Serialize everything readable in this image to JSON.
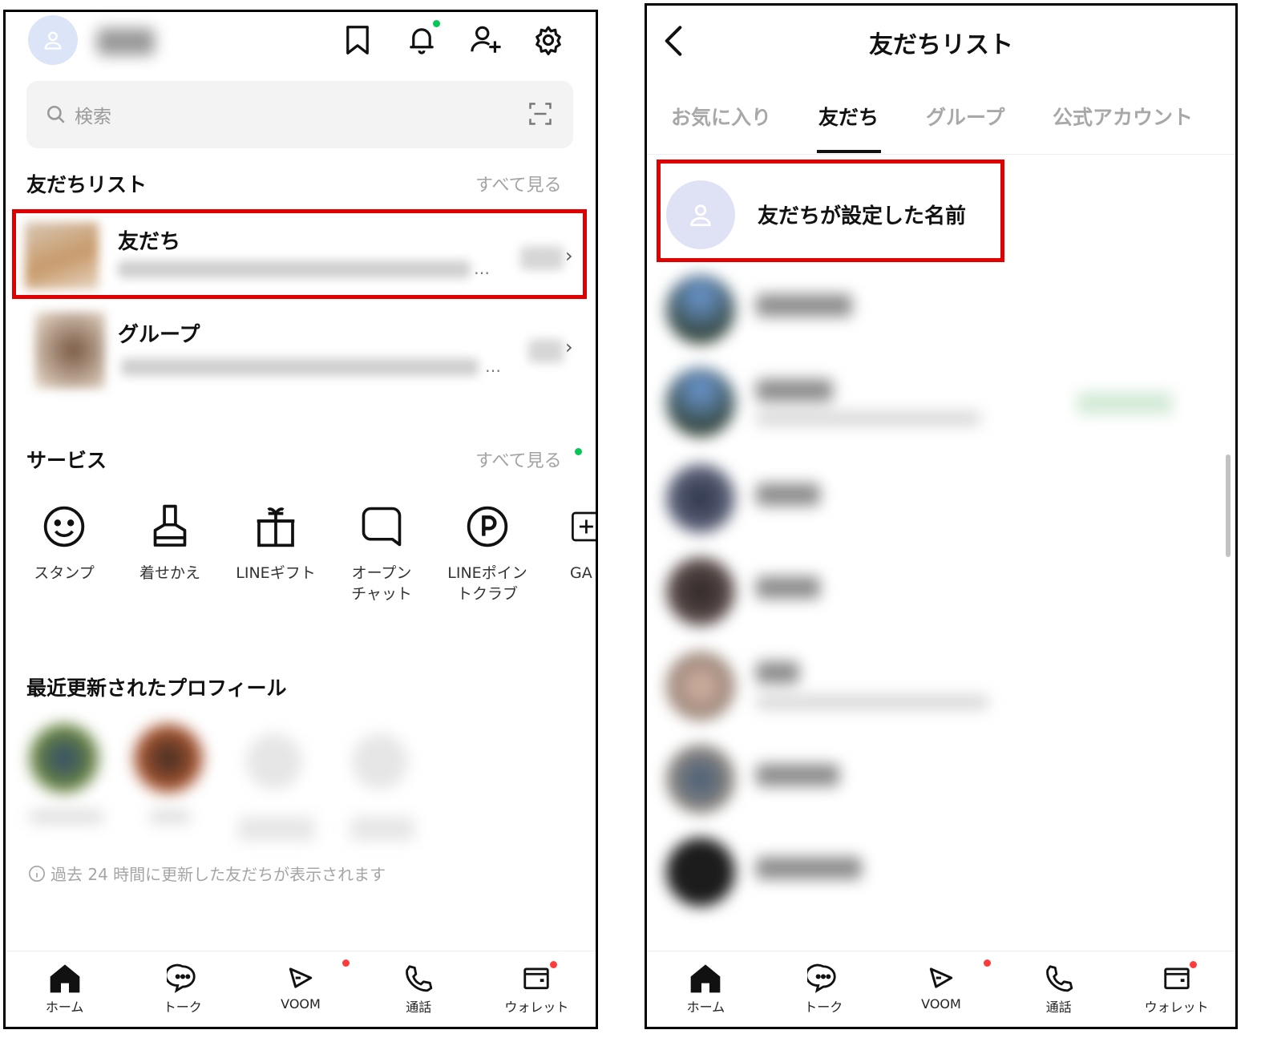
{
  "left": {
    "header": {
      "icons": [
        "bookmark-icon",
        "bell-icon",
        "add-friend-icon",
        "gear-icon"
      ],
      "notification_dot_color": "#06c755"
    },
    "search": {
      "placeholder": "検索"
    },
    "friends_section": {
      "title": "友だちリスト",
      "see_all": "すべて見る",
      "rows": [
        {
          "title": "友だち",
          "ellipsis": "…"
        },
        {
          "title": "グループ",
          "ellipsis": "…"
        }
      ]
    },
    "services": {
      "title": "サービス",
      "see_all": "すべて見る",
      "items": [
        {
          "label": "スタンプ",
          "icon": "smiley-icon"
        },
        {
          "label": "着せかえ",
          "icon": "brush-icon"
        },
        {
          "label": "LINEギフト",
          "icon": "gift-icon"
        },
        {
          "label": "オープン\nチャット",
          "icon": "chat-square-icon"
        },
        {
          "label": "LINEポイン\nトクラブ",
          "icon": "points-icon"
        },
        {
          "label": "GA",
          "icon": "plus-box-icon"
        }
      ]
    },
    "recent": {
      "title": "最近更新されたプロフィール",
      "note": "過去 24 時間に更新した友だちが表示されます"
    }
  },
  "right": {
    "title": "友だちリスト",
    "tabs": [
      "お気に入り",
      "友だち",
      "グループ",
      "公式アカウント"
    ],
    "active_tab": 1,
    "first_friend_name": "友だちが設定した名前"
  },
  "nav": {
    "items": [
      {
        "label": "ホーム",
        "icon": "home-icon"
      },
      {
        "label": "トーク",
        "icon": "chat-icon"
      },
      {
        "label": "VOOM",
        "icon": "voom-icon"
      },
      {
        "label": "通話",
        "icon": "phone-icon"
      },
      {
        "label": "ウォレット",
        "icon": "wallet-icon"
      }
    ],
    "badge_color": "#ff3b3b"
  },
  "colors": {
    "highlight": "#e00000",
    "accent_green": "#06c755"
  }
}
